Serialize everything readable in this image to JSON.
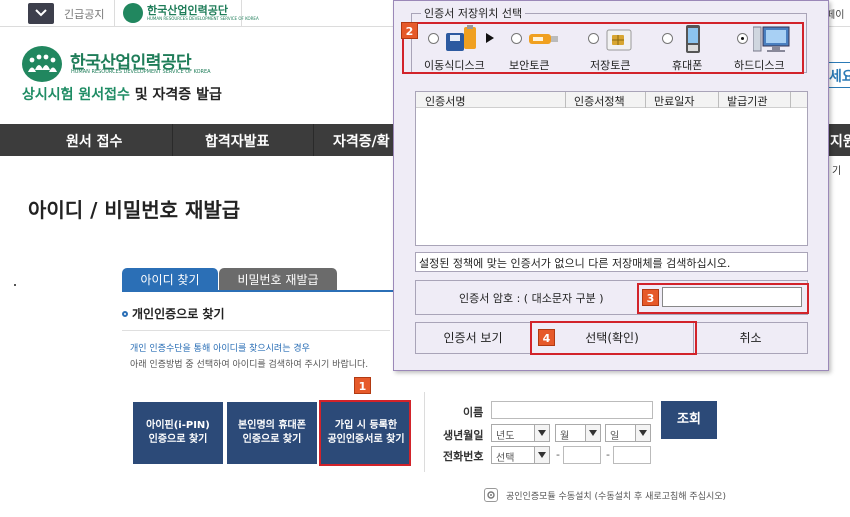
{
  "topbar": {
    "notice_label": "긴급공지",
    "mini_logo_ko": "한국산업인력공단",
    "mini_logo_en": "HUMAN RESOURCES DEVELOPMENT SERVICE OF KOREA",
    "right_cut_text": "페이"
  },
  "header": {
    "logo_ko": "한국산업인력공단",
    "logo_en": "HUMAN RESOURCES DEVELOPMENT SERVICE OF KOREA",
    "subtitle_green": "상시시험 원서접수",
    "subtitle_dark": " 및 자격증 발급",
    "right_cut_box": "세요"
  },
  "nav": {
    "items": [
      "원서 접수",
      "합격자발표",
      "자격증/확"
    ],
    "right_cut_item": "지원",
    "right_cut_small": "기"
  },
  "page": {
    "title": "아이디 / 비밀번호 재발급"
  },
  "tabs": [
    {
      "label": "아이디 찾기",
      "active": true
    },
    {
      "label": "비밀번호 재발급",
      "active": false
    }
  ],
  "section": {
    "label": "개인인증으로 찾기",
    "desc_line1": "개인 인증수단을 통해 아이디를 찾으시려는 경우",
    "desc_line2": "아래 인증방법 중 선택하여 아이디를 검색하여 주시기 바랍니다."
  },
  "auth_buttons": [
    "아이핀(i-PIN)\n인증으로 찾기",
    "본인명의 휴대폰\n인증으로 찾기",
    "가입 시 등록한\n공인인증서로 찾기"
  ],
  "form": {
    "name_label": "이름",
    "birth_label": "생년월일",
    "phone_label": "전화번호",
    "year_placeholder": "년도",
    "month_placeholder": "월",
    "day_placeholder": "일",
    "phone_select": "선택",
    "dash": "-",
    "search_button": "조회"
  },
  "install_note": "공인인증모듈 수동설치 (수동설치 후 새로고침해 주십시오)",
  "dialog": {
    "storage_title": "인증서 저장위치 선택",
    "media": [
      {
        "label": "이동식디스크",
        "icon": "usb-disk-icon",
        "selected": false
      },
      {
        "label": "보안토큰",
        "icon": "security-token-icon",
        "selected": false
      },
      {
        "label": "저장토큰",
        "icon": "storage-token-icon",
        "selected": false
      },
      {
        "label": "휴대폰",
        "icon": "mobile-phone-icon",
        "selected": false
      },
      {
        "label": "하드디스크",
        "icon": "hard-disk-icon",
        "selected": true
      }
    ],
    "table_columns": [
      "인증서명",
      "인증서정책",
      "만료일자",
      "발급기관"
    ],
    "status_message": "설정된 정책에 맞는 인증서가 없으니 다른 저장매체를 검색하십시오.",
    "password_label": "인증서 암호 : ( 대소문자 구분 )",
    "buttons": {
      "view": "인증서 보기",
      "confirm": "선택(확인)",
      "cancel": "취소"
    }
  },
  "annotations": {
    "badge1": "1",
    "badge2": "2",
    "badge3": "3",
    "badge4": "4"
  },
  "colors": {
    "brand_green": "#1f7d59",
    "nav_dark": "#3c3c3c",
    "tab_blue": "#2b6fb6",
    "button_navy": "#2c4a78",
    "highlight_red": "#d2232a",
    "badge_orange": "#e65a2a",
    "dialog_bg": "#efecf6"
  }
}
